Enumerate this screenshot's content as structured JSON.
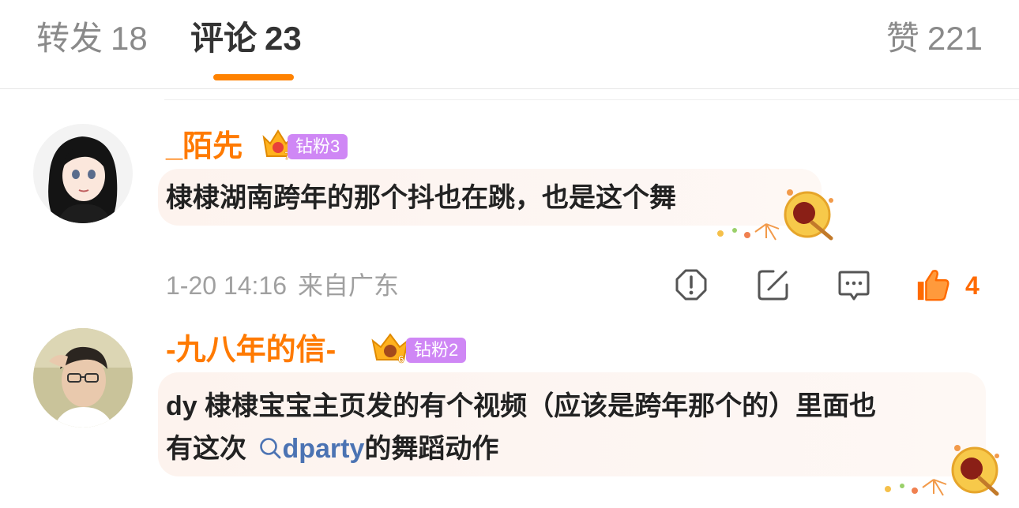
{
  "tabs": {
    "repost": {
      "label": "转发",
      "count": "18"
    },
    "comment": {
      "label": "评论",
      "count": "23"
    },
    "like": {
      "label": "赞",
      "count": "221"
    }
  },
  "comments": [
    {
      "username": "_陌先",
      "badge_level": "7",
      "badge_label": "钻粉3",
      "text": "棣棣湖南跨年的那个抖也在跳，也是这个舞",
      "time": "1-20 14:16",
      "location": "来自广东",
      "likes": "4"
    },
    {
      "username": "-九八年的信-",
      "badge_level": "6",
      "badge_label": "钻粉2",
      "text_line1": "dy 棣棣宝宝主页发的有个视频（应该是跨年那个的）里面也",
      "text_line2_prefix": "有这次",
      "hashtag": "dparty",
      "text_line2_suffix": "的舞蹈动作"
    }
  ],
  "colors": {
    "accent": "#ff8200",
    "username": "#ff7a00",
    "badge": "#cf87f5",
    "hashtag": "#4b73b3",
    "like_active": "#ff6a00",
    "meta": "#a0a0a0"
  },
  "icons": [
    "crown-badge-icon",
    "report-icon",
    "repost-icon",
    "reply-icon",
    "like-icon",
    "search-icon",
    "firework-sticker-icon"
  ]
}
